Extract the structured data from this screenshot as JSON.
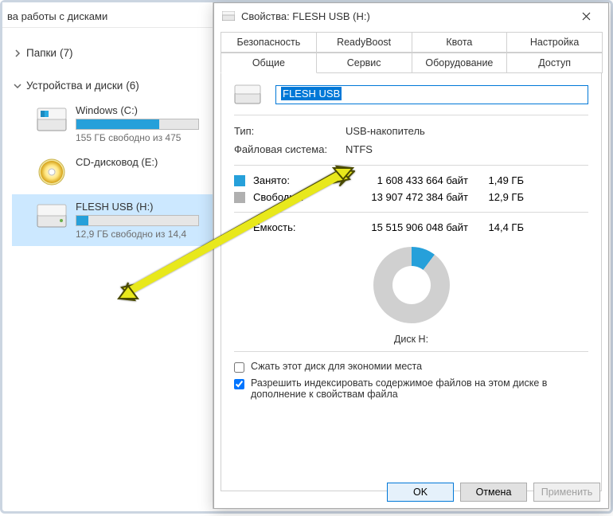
{
  "explorer": {
    "header": "ва работы с дисками",
    "folders": {
      "label": "Папки",
      "count": "(7)"
    },
    "devices": {
      "label": "Устройства и диски",
      "count": "(6)"
    },
    "drives": [
      {
        "name": "Windows (C:)",
        "free": "155 ГБ свободно из 475",
        "fill_pct": 68,
        "type": "hdd-win"
      },
      {
        "name": "CD-дисковод (E:)",
        "free": "",
        "fill_pct": 0,
        "type": "cd"
      },
      {
        "name": "FLESH USB (H:)",
        "free": "12,9 ГБ свободно из 14,4",
        "fill_pct": 10,
        "type": "hdd",
        "selected": true
      }
    ]
  },
  "dialog": {
    "title": "Свойства: FLESH USB (H:)",
    "tabs_top": [
      "Безопасность",
      "ReadyBoost",
      "Квота",
      "Настройка"
    ],
    "tabs_bottom": [
      "Общие",
      "Сервис",
      "Оборудование",
      "Доступ"
    ],
    "active_tab": "Общие",
    "name_value": "FLESH USB",
    "type_label": "Тип:",
    "type_value": "USB-накопитель",
    "fs_label": "Файловая система:",
    "fs_value": "NTFS",
    "used_label": "Занято:",
    "used_bytes": "1 608 433 664 байт",
    "used_gb": "1,49 ГБ",
    "free_label": "Свободно:",
    "free_bytes": "13 907 472 384 байт",
    "free_gb": "12,9 ГБ",
    "cap_label": "Емкость:",
    "cap_bytes": "15 515 906 048 байт",
    "cap_gb": "14,4 ГБ",
    "pie_label": "Диск H:",
    "compress_label": "Сжать этот диск для экономии места",
    "index_label": "Разрешить индексировать содержимое файлов на этом диске в дополнение к свойствам файла",
    "ok": "OK",
    "cancel": "Отмена",
    "apply": "Применить"
  }
}
